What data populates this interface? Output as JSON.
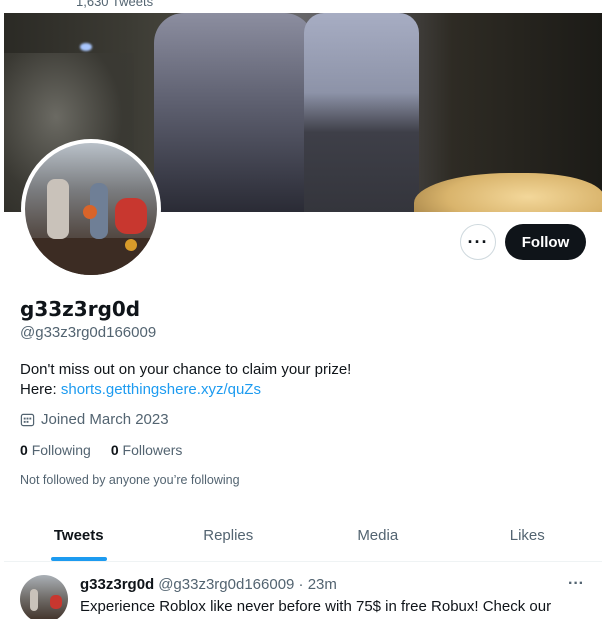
{
  "header": {
    "tweet_count": "1,630 Tweets"
  },
  "profile": {
    "display_name": "g33z3rg0d",
    "handle": "@g33z3rg0d166009",
    "bio_text": "Don't miss out on your chance to claim your prize!",
    "bio_prefix": "Here: ",
    "bio_link": "shorts.getthingshere.xyz/quZs",
    "joined": "Joined March 2023",
    "following_count": "0",
    "following_label": "Following",
    "followers_count": "0",
    "followers_label": "Followers",
    "not_followed_text": "Not followed by anyone you’re following"
  },
  "actions": {
    "more_icon": "more-horizontal-icon",
    "follow_label": "Follow"
  },
  "tabs": [
    {
      "label": "Tweets",
      "active": true
    },
    {
      "label": "Replies",
      "active": false
    },
    {
      "label": "Media",
      "active": false
    },
    {
      "label": "Likes",
      "active": false
    }
  ],
  "tweet": {
    "name": "g33z3rg0d",
    "handle_time": "@g33z3rg0d166009 · 23m",
    "text": "Experience Roblox like never before with 75$ in free Robux! Check our"
  },
  "colors": {
    "accent": "#1d9bf0",
    "text": "#0f1419",
    "muted": "#536471",
    "button_dark": "#0f1419"
  }
}
